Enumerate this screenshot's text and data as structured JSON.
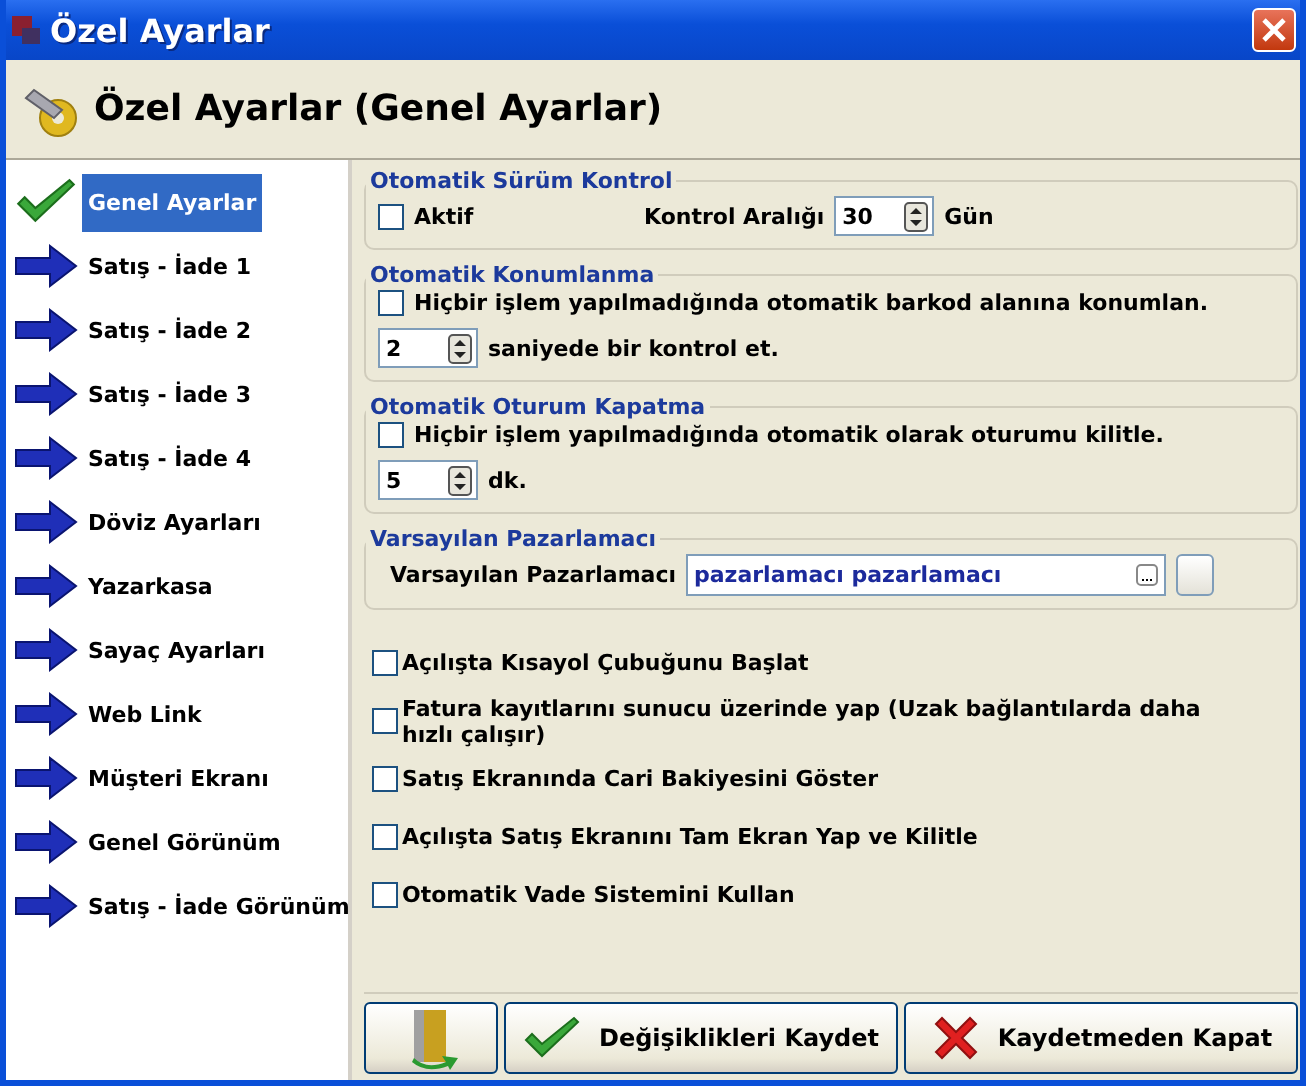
{
  "window": {
    "title": "Özel Ayarlar"
  },
  "header": {
    "title": "Özel Ayarlar (Genel Ayarlar)"
  },
  "sidebar": {
    "items": [
      {
        "label": "Genel Ayarlar",
        "selected": true
      },
      {
        "label": "Satış - İade 1",
        "selected": false
      },
      {
        "label": "Satış - İade 2",
        "selected": false
      },
      {
        "label": "Satış - İade 3",
        "selected": false
      },
      {
        "label": "Satış - İade 4",
        "selected": false
      },
      {
        "label": "Döviz Ayarları",
        "selected": false
      },
      {
        "label": "Yazarkasa",
        "selected": false
      },
      {
        "label": "Sayaç Ayarları",
        "selected": false
      },
      {
        "label": "Web Link",
        "selected": false
      },
      {
        "label": "Müşteri Ekranı",
        "selected": false
      },
      {
        "label": "Genel Görünüm",
        "selected": false
      },
      {
        "label": "Satış - İade Görünüm",
        "selected": false
      }
    ]
  },
  "version_control": {
    "title": "Otomatik Sürüm Kontrol",
    "active": {
      "label": "Aktif",
      "checked": false
    },
    "interval_label": "Kontrol Aralığı",
    "interval_value": "30",
    "unit": "Gün"
  },
  "auto_position": {
    "title": "Otomatik Konumlanma",
    "option": {
      "label": "Hiçbir işlem yapılmadığında otomatik barkod alanına konumlan.",
      "checked": false
    },
    "value": "2",
    "unit": "saniyede bir kontrol et."
  },
  "auto_logout": {
    "title": "Otomatik Oturum Kapatma",
    "option": {
      "label": "Hiçbir işlem yapılmadığında otomatik olarak oturumu kilitle.",
      "checked": false
    },
    "value": "5",
    "unit": "dk."
  },
  "default_marketer": {
    "title": "Varsayılan Pazarlamacı",
    "label": "Varsayılan Pazarlamacı",
    "value": "pazarlamacı pazarlamacı"
  },
  "options": [
    {
      "label": "Açılışta Kısayol Çubuğunu Başlat",
      "checked": false
    },
    {
      "label": "Fatura kayıtlarını sunucu üzerinde yap (Uzak bağlantılarda daha hızlı çalışır)",
      "checked": false
    },
    {
      "label": "Satış Ekranında Cari Bakiyesini Göster",
      "checked": false
    },
    {
      "label": "Açılışta Satış Ekranını Tam Ekran Yap ve Kilitle",
      "checked": false
    },
    {
      "label": "Otomatik Vade Sistemini Kullan",
      "checked": false
    }
  ],
  "buttons": [
    {
      "kind": "exit"
    },
    {
      "kind": "save",
      "label": "Değişiklikleri Kaydet"
    },
    {
      "kind": "cancel",
      "label": "Kaydetmeden Kapat"
    }
  ]
}
